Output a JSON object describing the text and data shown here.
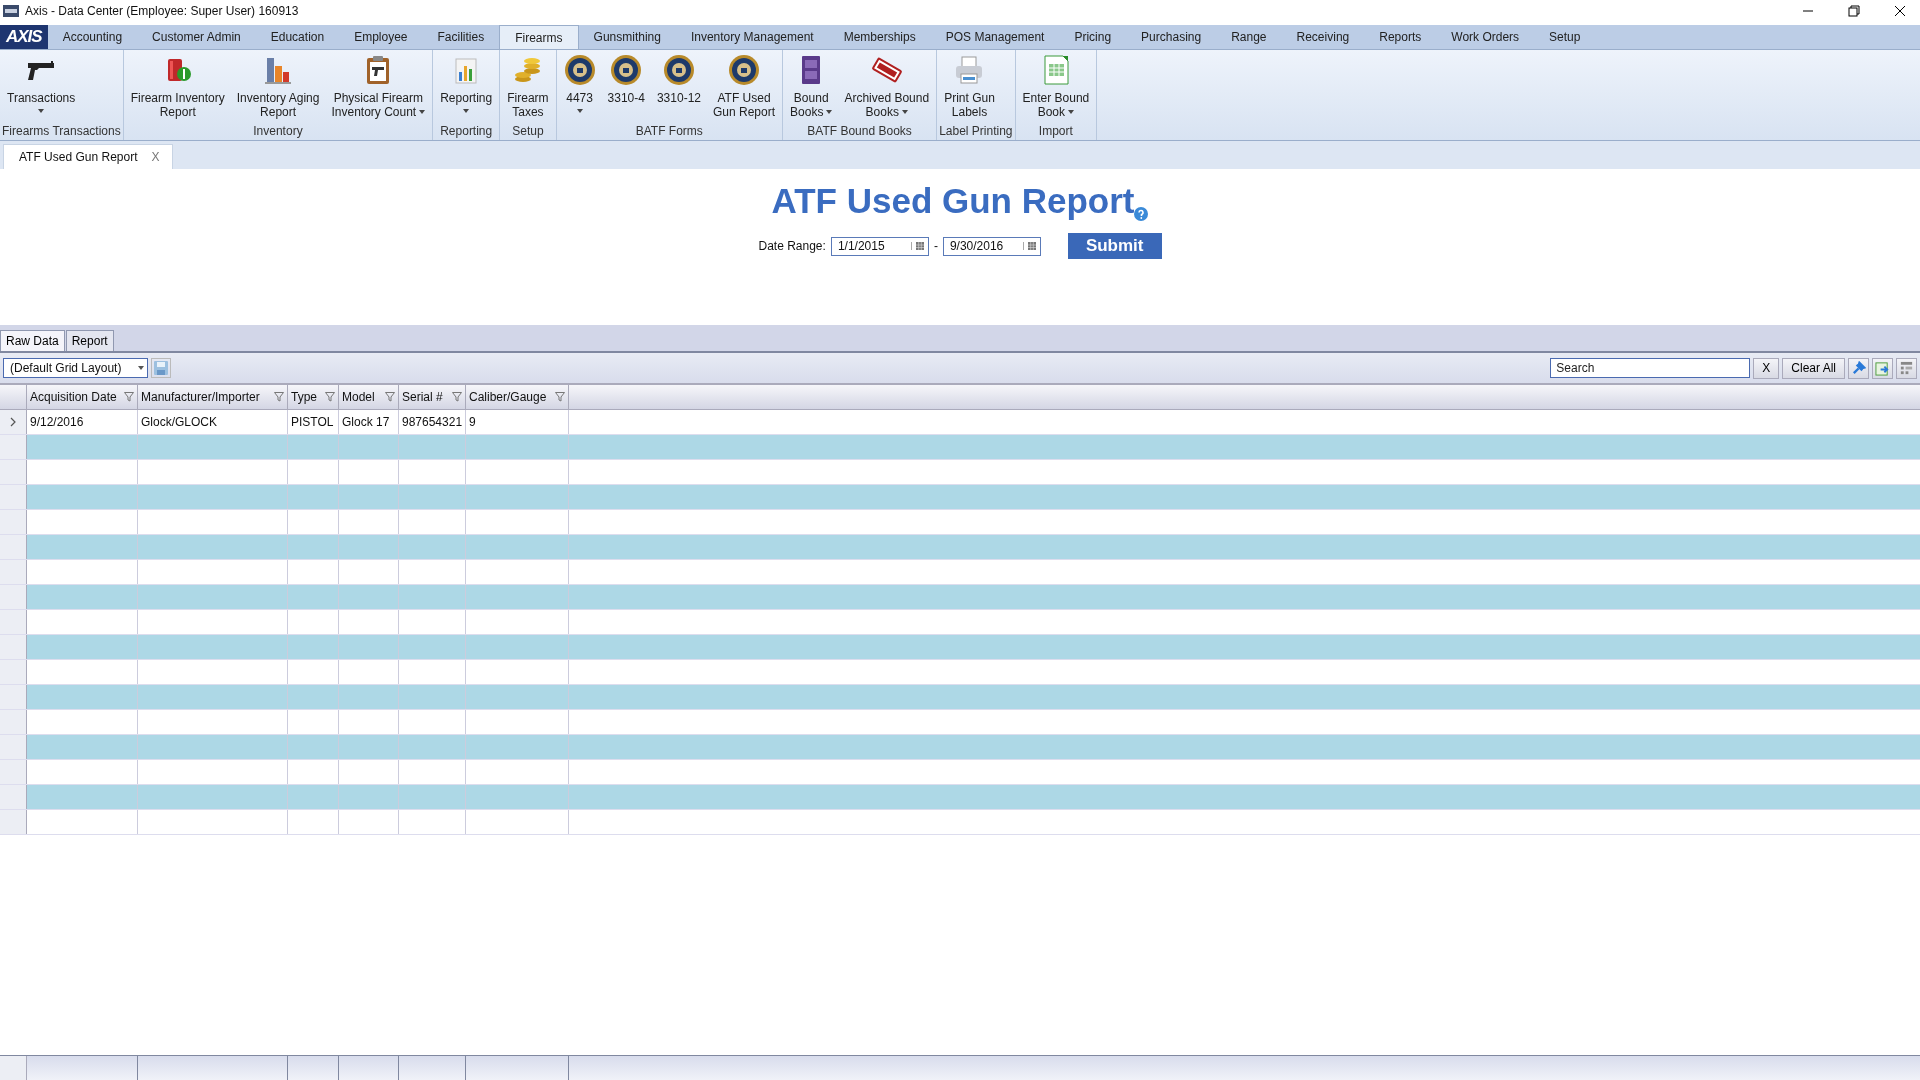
{
  "window": {
    "title": "Axis - Data Center  (Employee: Super User) 160913"
  },
  "app_logo": {
    "label": "AXIS"
  },
  "menu_tabs": [
    {
      "label": "Accounting",
      "selected": false
    },
    {
      "label": "Customer Admin",
      "selected": false
    },
    {
      "label": "Education",
      "selected": false
    },
    {
      "label": "Employee",
      "selected": false
    },
    {
      "label": "Facilities",
      "selected": false
    },
    {
      "label": "Firearms",
      "selected": true
    },
    {
      "label": "Gunsmithing",
      "selected": false
    },
    {
      "label": "Inventory Management",
      "selected": false
    },
    {
      "label": "Memberships",
      "selected": false
    },
    {
      "label": "POS Management",
      "selected": false
    },
    {
      "label": "Pricing",
      "selected": false
    },
    {
      "label": "Purchasing",
      "selected": false
    },
    {
      "label": "Range",
      "selected": false
    },
    {
      "label": "Receiving",
      "selected": false
    },
    {
      "label": "Reports",
      "selected": false
    },
    {
      "label": "Work Orders",
      "selected": false
    },
    {
      "label": "Setup",
      "selected": false
    }
  ],
  "ribbon_groups": [
    {
      "label": "Firearms Transactions",
      "buttons": [
        {
          "label": "Transactions",
          "dropdown": true
        }
      ]
    },
    {
      "label": "Inventory",
      "buttons": [
        {
          "label": "Firearm Inventory\nReport",
          "dropdown": false
        },
        {
          "label": "Inventory Aging\nReport",
          "dropdown": false
        },
        {
          "label": "Physical Firearm\nInventory Count",
          "dropdown": true
        }
      ]
    },
    {
      "label": "Reporting",
      "buttons": [
        {
          "label": "Reporting",
          "dropdown": true
        }
      ]
    },
    {
      "label": "Setup",
      "buttons": [
        {
          "label": "Firearm\nTaxes",
          "dropdown": false
        }
      ]
    },
    {
      "label": "BATF Forms",
      "buttons": [
        {
          "label": "4473",
          "dropdown": true
        },
        {
          "label": "3310-4",
          "dropdown": false
        },
        {
          "label": "3310-12",
          "dropdown": false
        },
        {
          "label": "ATF Used\nGun Report",
          "dropdown": false
        }
      ]
    },
    {
      "label": "BATF Bound Books",
      "buttons": [
        {
          "label": "Bound\nBooks",
          "dropdown": true
        },
        {
          "label": "Archived Bound\nBooks",
          "dropdown": true
        }
      ]
    },
    {
      "label": "Label Printing",
      "buttons": [
        {
          "label": "Print Gun\nLabels",
          "dropdown": false
        }
      ]
    },
    {
      "label": "Import",
      "buttons": [
        {
          "label": "Enter Bound\nBook",
          "dropdown": true
        }
      ]
    }
  ],
  "document_tabs": [
    {
      "label": "ATF Used Gun Report",
      "close": "X",
      "selected": true
    }
  ],
  "report": {
    "title": "ATF Used Gun Report",
    "date_range_label": "Date Range:",
    "date_from": "1/1/2015",
    "separator": "-",
    "date_to": "9/30/2016",
    "submit": "Submit"
  },
  "view_tabs": [
    {
      "label": "Raw Data",
      "selected": true
    },
    {
      "label": "Report",
      "selected": false
    }
  ],
  "grid_toolbar": {
    "layout": "(Default Grid Layout)",
    "search_placeholder": "Search",
    "clear_search": "X",
    "clear_all": "Clear All"
  },
  "table": {
    "columns": [
      "Acquisition Date",
      "Manufacturer/Importer",
      "Type",
      "Model",
      "Serial #",
      "Caliber/Gauge"
    ],
    "rows": [
      {
        "current": true,
        "cells": [
          "9/12/2016",
          "Glock/GLOCK",
          "PISTOL",
          "Glock 17",
          "987654321",
          "9"
        ]
      }
    ]
  }
}
